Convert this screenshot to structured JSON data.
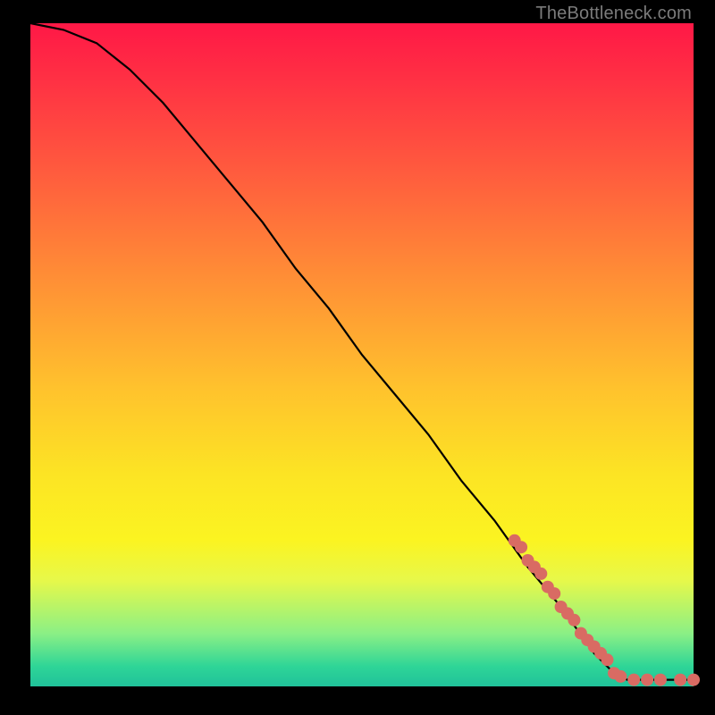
{
  "attribution": "TheBottleneck.com",
  "chart_data": {
    "type": "line",
    "title": "",
    "xlabel": "",
    "ylabel": "",
    "xlim": [
      0,
      100
    ],
    "ylim": [
      0,
      100
    ],
    "background_gradient": [
      "#ff1846",
      "#ff5a3e",
      "#ffc22d",
      "#fbf421",
      "#2ed597"
    ],
    "series": [
      {
        "name": "curve",
        "x": [
          0,
          5,
          10,
          15,
          20,
          25,
          30,
          35,
          40,
          45,
          50,
          55,
          60,
          65,
          70,
          75,
          80,
          85,
          88,
          90,
          92,
          95,
          100
        ],
        "y": [
          100,
          99,
          97,
          93,
          88,
          82,
          76,
          70,
          63,
          57,
          50,
          44,
          38,
          31,
          25,
          18,
          12,
          5,
          2,
          1,
          1,
          1,
          1
        ]
      }
    ],
    "points": {
      "name": "highlighted-segment",
      "color": "#d96b63",
      "x": [
        73,
        74,
        75,
        76,
        77,
        78,
        79,
        80,
        81,
        82,
        83,
        84,
        85,
        86,
        87,
        88,
        89,
        91,
        93,
        95,
        98,
        100
      ],
      "y": [
        22,
        21,
        19,
        18,
        17,
        15,
        14,
        12,
        11,
        10,
        8,
        7,
        6,
        5,
        4,
        2,
        1.5,
        1,
        1,
        1,
        1,
        1
      ]
    }
  }
}
